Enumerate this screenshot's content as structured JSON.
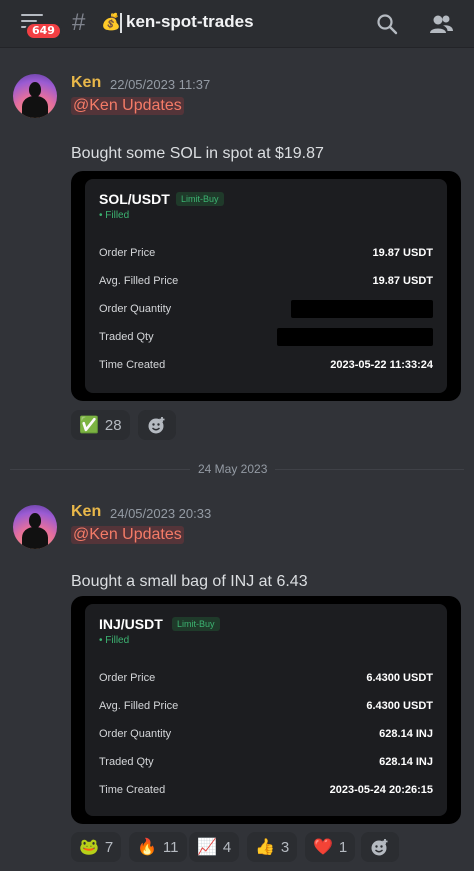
{
  "header": {
    "notification_count": "649",
    "channel_emoji": "💰",
    "channel_name": "ken-spot-trades"
  },
  "date_divider": "24 May 2023",
  "messages": [
    {
      "author": "Ken",
      "timestamp": "22/05/2023 11:37",
      "mention": "@Ken Updates",
      "text": "Bought some SOL in spot at $19.87",
      "card": {
        "pair": "SOL/USDT",
        "tag": "Limit-Buy",
        "status": "• Filled",
        "rows": [
          {
            "label": "Order Price",
            "value": "19.87 USDT"
          },
          {
            "label": "Avg. Filled Price",
            "value": "19.87 USDT"
          },
          {
            "label": "Order Quantity",
            "value": ""
          },
          {
            "label": "Traded Qty",
            "value": ""
          },
          {
            "label": "Time Created",
            "value": "2023-05-22 11:33:24"
          }
        ]
      },
      "reactions": [
        {
          "emoji": "✅",
          "count": "28"
        }
      ]
    },
    {
      "author": "Ken",
      "timestamp": "24/05/2023 20:33",
      "mention": "@Ken Updates",
      "text": "Bought a small bag of INJ at 6.43",
      "card": {
        "pair": "INJ/USDT",
        "tag": "Limit-Buy",
        "status": "• Filled",
        "rows": [
          {
            "label": "Order Price",
            "value": "6.4300 USDT"
          },
          {
            "label": "Avg. Filled Price",
            "value": "6.4300 USDT"
          },
          {
            "label": "Order Quantity",
            "value": "628.14 INJ"
          },
          {
            "label": "Traded Qty",
            "value": "628.14 INJ"
          },
          {
            "label": "Time Created",
            "value": "2023-05-24 20:26:15"
          }
        ]
      },
      "reactions": [
        {
          "emoji": "🐸",
          "count": "7"
        },
        {
          "emoji": "🔥",
          "count": "11"
        },
        {
          "emoji": "📈",
          "count": "4"
        },
        {
          "emoji": "👍",
          "count": "3"
        },
        {
          "emoji": "❤️",
          "count": "1"
        }
      ]
    }
  ],
  "icons": {
    "menu": "hamburger-menu-icon",
    "search": "search-icon",
    "members": "members-icon",
    "add_reaction": "add-reaction-icon"
  }
}
